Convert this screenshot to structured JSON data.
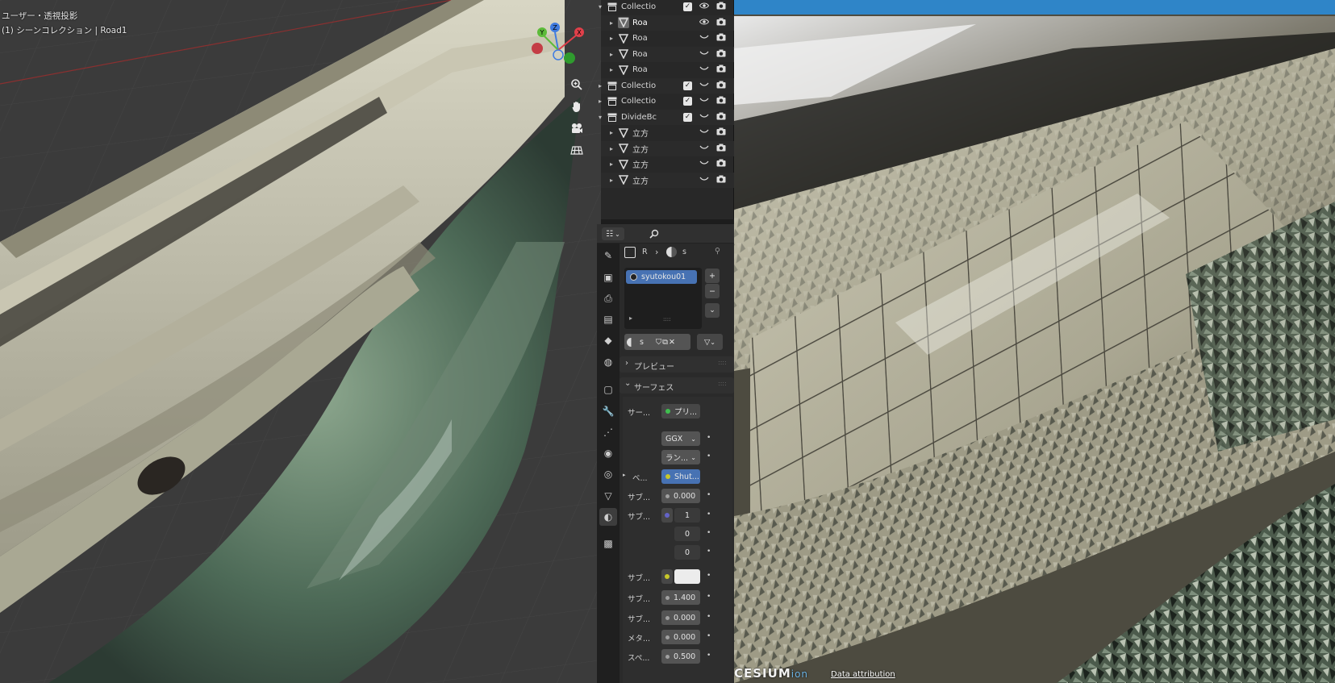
{
  "viewport": {
    "view_mode": "ユーザー・透視投影",
    "collection_info": "(1) シーンコレクション | Road1",
    "gizmo": {
      "x": "X",
      "y": "Y",
      "z": "Z"
    },
    "tools": [
      "zoom-icon",
      "hand-icon",
      "camera-icon",
      "grid-icon"
    ]
  },
  "outliner": {
    "rows": [
      {
        "label": "Collectio",
        "type": "collection",
        "indent": 0,
        "expanded": true,
        "checked": true,
        "visible": true
      },
      {
        "label": "Roa",
        "type": "mesh",
        "indent": 1,
        "selected": true,
        "visible": true
      },
      {
        "label": "Roa",
        "type": "mesh",
        "indent": 1,
        "visible": false
      },
      {
        "label": "Roa",
        "type": "mesh",
        "indent": 1,
        "visible": false
      },
      {
        "label": "Roa",
        "type": "mesh",
        "indent": 1,
        "visible": false
      },
      {
        "label": "Collectio",
        "type": "collection",
        "indent": 0,
        "checked": true,
        "visible": false
      },
      {
        "label": "Collectio",
        "type": "collection",
        "indent": 0,
        "checked": true,
        "visible": false
      },
      {
        "label": "DivideBc",
        "type": "collection",
        "indent": 0,
        "expanded": true,
        "checked": true,
        "visible": false
      },
      {
        "label": "立方",
        "type": "mesh",
        "indent": 1,
        "visible": false
      },
      {
        "label": "立方",
        "type": "mesh",
        "indent": 1,
        "visible": false
      },
      {
        "label": "立方",
        "type": "mesh",
        "indent": 1,
        "visible": false
      },
      {
        "label": "立方",
        "type": "mesh",
        "indent": 1,
        "visible": false
      }
    ]
  },
  "properties": {
    "breadcrumb": {
      "object": "R",
      "material": "s"
    },
    "material_slot": "syutokou01",
    "material_name": "s",
    "sections": {
      "preview": "プレビュー",
      "surface": "サーフェス"
    },
    "surface_label": "サー...",
    "surface_value": "プリ...",
    "distribution": "GGX",
    "subsurface_method": "ラン...",
    "base_color_label": "ベ...",
    "base_color_value": "Shut...",
    "rows": [
      {
        "label": "サブ...",
        "value": "0.000"
      },
      {
        "label": "サブ...",
        "value": "1"
      },
      {
        "label": "",
        "value": "0"
      },
      {
        "label": "",
        "value": "0"
      },
      {
        "label": "サブ...",
        "value": ""
      },
      {
        "label": "サブ...",
        "value": "1.400"
      },
      {
        "label": "サブ...",
        "value": "0.000"
      },
      {
        "label": "メタ...",
        "value": "0.000"
      },
      {
        "label": "スペ...",
        "value": "0.500"
      }
    ],
    "accent": "#4772b3"
  },
  "render_view": {
    "logo": "CESIUM",
    "logo_suffix": "ion",
    "attribution": "Data attribution"
  }
}
